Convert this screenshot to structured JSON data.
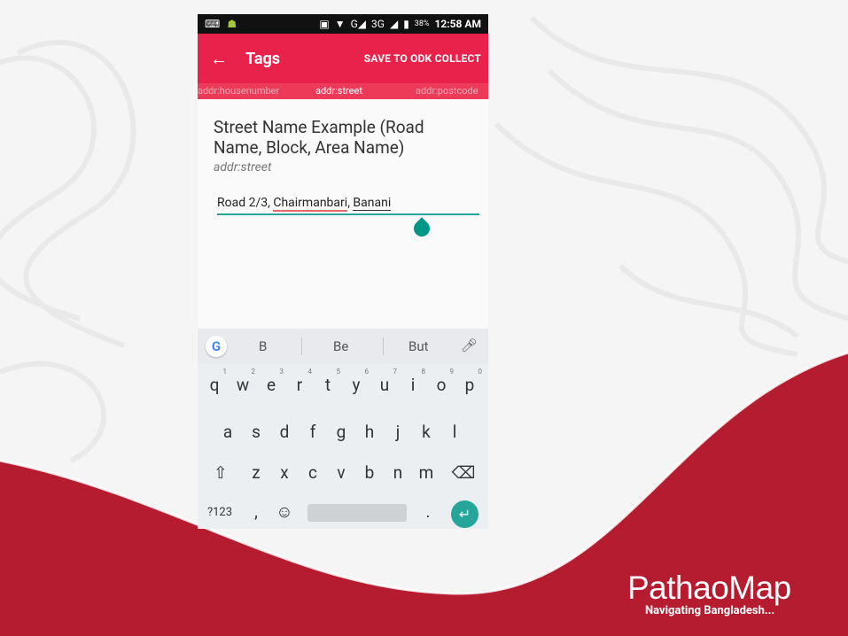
{
  "colors": {
    "primary": "#e8224a",
    "accent": "#26a69a",
    "brand_red": "#b51c2f"
  },
  "status_bar": {
    "battery": "38%",
    "network": "3G",
    "time": "12:58 AM"
  },
  "app_bar": {
    "title": "Tags",
    "action": "SAVE TO ODK COLLECT"
  },
  "tabs": [
    "addr:housenumber",
    "addr:street",
    "addr:postcode"
  ],
  "active_tab": "addr:street",
  "field": {
    "label": "Street Name Example (Road Name, Block, Area Name)",
    "key": "addr:street",
    "value_parts": [
      "Road 2/3, ",
      "Chairmanbari",
      ", ",
      "Banani"
    ]
  },
  "keyboard": {
    "suggestions": [
      "B",
      "Be",
      "But"
    ],
    "row1": [
      "q",
      "w",
      "e",
      "r",
      "t",
      "y",
      "u",
      "i",
      "o",
      "p"
    ],
    "row1_hints": [
      "1",
      "2",
      "3",
      "4",
      "5",
      "6",
      "7",
      "8",
      "9",
      "0"
    ],
    "row2": [
      "a",
      "s",
      "d",
      "f",
      "g",
      "h",
      "j",
      "k",
      "l"
    ],
    "row3": [
      "z",
      "x",
      "c",
      "v",
      "b",
      "n",
      "m"
    ],
    "symbols_key": "?123",
    "comma": ",",
    "period": "."
  },
  "branding": {
    "name": "PathaoMap",
    "tagline": "Navigating Bangladesh..."
  }
}
